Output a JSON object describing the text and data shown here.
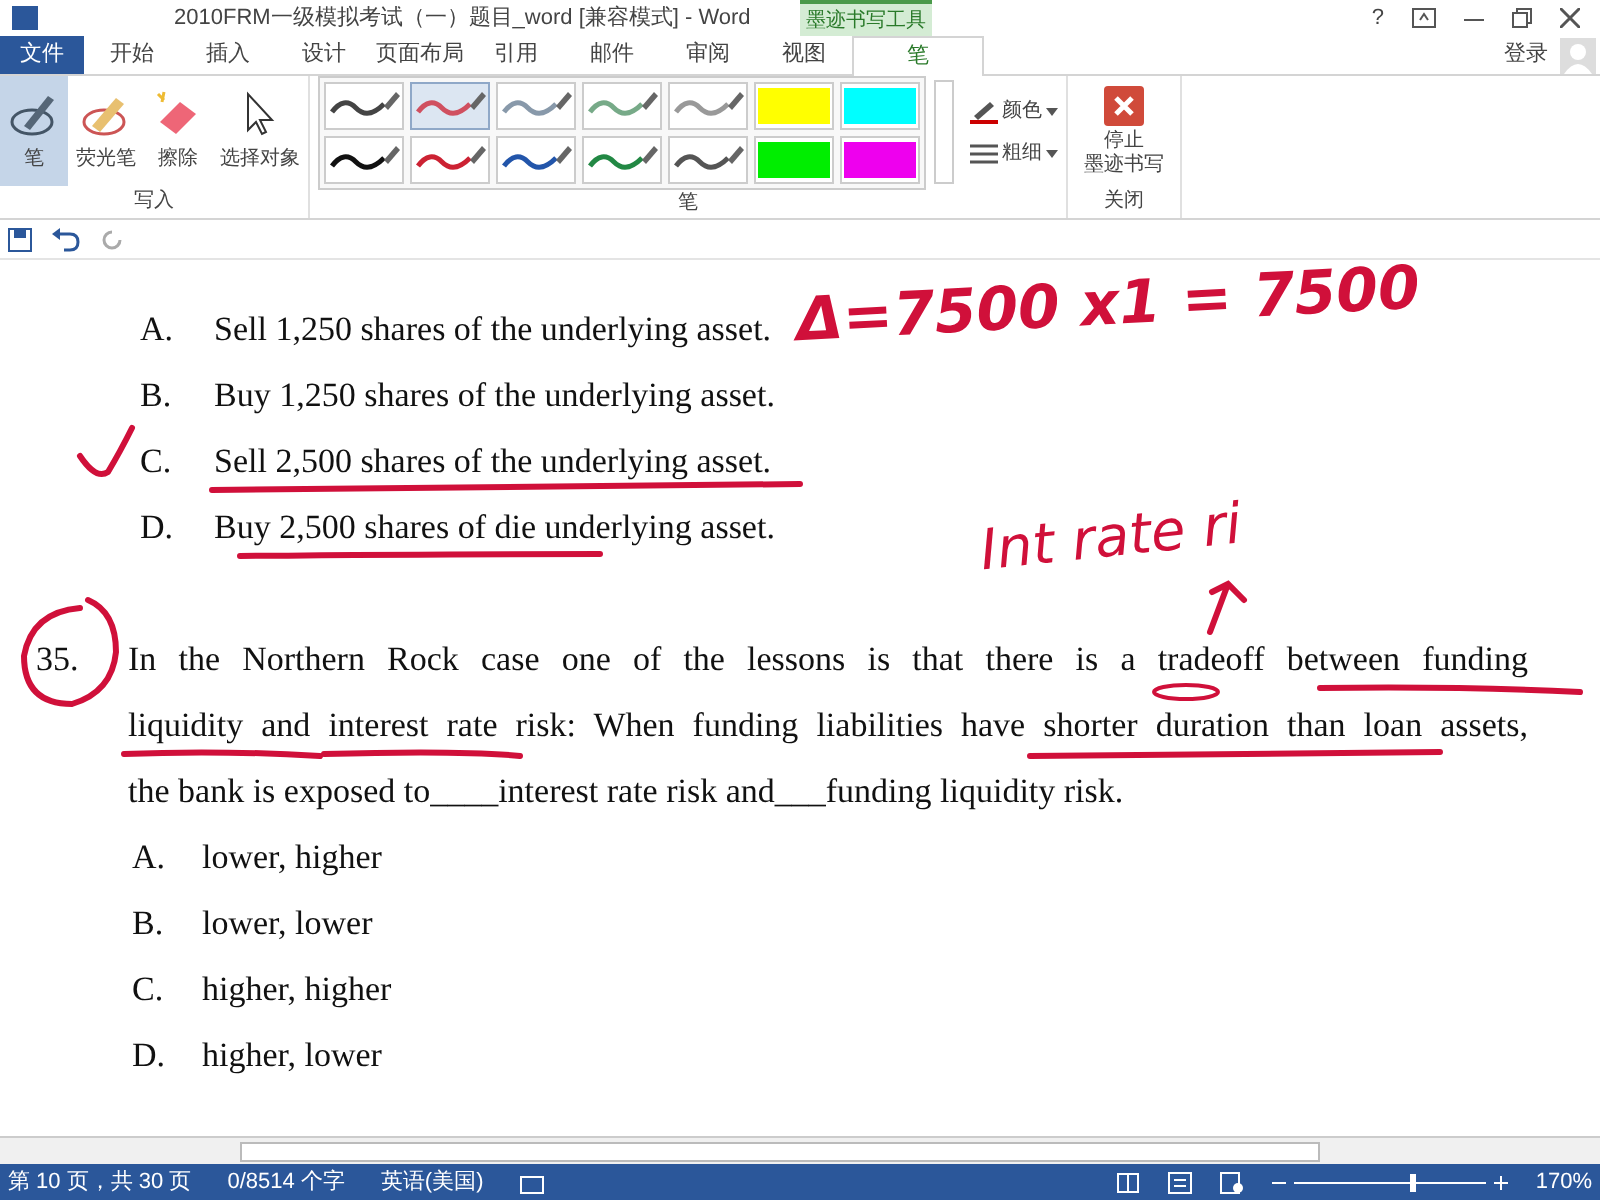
{
  "window": {
    "title": "2010FRM一级模拟考试（一）题目_word [兼容模式] - Word",
    "help": "?",
    "signin": "登录"
  },
  "tabs": [
    {
      "label": "文件",
      "kind": "file",
      "selected": false
    },
    {
      "label": "开始",
      "kind": "tab",
      "selected": false
    },
    {
      "label": "插入",
      "kind": "tab",
      "selected": false
    },
    {
      "label": "设计",
      "kind": "tab",
      "selected": false
    },
    {
      "label": "页面布局",
      "kind": "tab",
      "selected": false
    },
    {
      "label": "引用",
      "kind": "tab",
      "selected": false
    },
    {
      "label": "邮件",
      "kind": "tab",
      "selected": false
    },
    {
      "label": "审阅",
      "kind": "tab",
      "selected": false
    },
    {
      "label": "视图",
      "kind": "tab",
      "selected": false
    },
    {
      "label": "笔",
      "kind": "context",
      "selected": true
    }
  ],
  "context_group": "墨迹书写工具",
  "ribbon": {
    "write_tools": [
      {
        "label": "笔",
        "kind": "pen",
        "selected": true
      },
      {
        "label": "荧光笔",
        "kind": "highlighter",
        "selected": false
      },
      {
        "label": "擦除",
        "kind": "eraser",
        "selected": false
      },
      {
        "label": "选择对象",
        "kind": "pointer",
        "selected": false
      }
    ],
    "write_group": "写入",
    "pens": [
      {
        "kind": "pen",
        "color": "#444444",
        "selected": false
      },
      {
        "kind": "pen",
        "color": "#d05060",
        "selected": true
      },
      {
        "kind": "pen",
        "color": "#8899aa",
        "selected": false
      },
      {
        "kind": "pen",
        "color": "#77aa88",
        "selected": false
      },
      {
        "kind": "pen",
        "color": "#999999",
        "selected": false
      },
      {
        "kind": "highlighter",
        "color": "#ffff00",
        "selected": false
      },
      {
        "kind": "highlighter",
        "color": "#00ffff",
        "selected": false
      },
      {
        "kind": "pen",
        "color": "#111111",
        "selected": false
      },
      {
        "kind": "pen",
        "color": "#cc2233",
        "selected": false
      },
      {
        "kind": "pen",
        "color": "#2255aa",
        "selected": false
      },
      {
        "kind": "pen",
        "color": "#228844",
        "selected": false
      },
      {
        "kind": "pen",
        "color": "#555555",
        "selected": false
      },
      {
        "kind": "highlighter",
        "color": "#00ee00",
        "selected": false
      },
      {
        "kind": "highlighter",
        "color": "#ee00ee",
        "selected": false
      }
    ],
    "color_button": "颜色",
    "thickness_button": "粗细",
    "pen_group": "笔",
    "stop_button": [
      "停止",
      "墨迹书写"
    ],
    "close_group": "关闭"
  },
  "document": {
    "options_top": [
      {
        "letter": "A.",
        "text": "Sell 1,250 shares of the underlying asset."
      },
      {
        "letter": "B.",
        "text": "Buy 1,250 shares of the underlying asset."
      },
      {
        "letter": "C.",
        "text": "Sell 2,500 shares of the underlying asset."
      },
      {
        "letter": "D.",
        "text": "Buy 2,500 shares of die underlying asset."
      }
    ],
    "question": {
      "number": "35.",
      "lines": [
        "In the Northern Rock case one of the lessons is that there is a tradeoff between funding",
        "liquidity and interest rate risk: When funding liabilities have shorter duration than loan assets,",
        "the bank is exposed to____interest rate risk and___funding liquidity risk."
      ]
    },
    "options": [
      {
        "letter": "A.",
        "text": "lower, higher"
      },
      {
        "letter": "B.",
        "text": "lower, lower"
      },
      {
        "letter": "C.",
        "text": "higher, higher"
      },
      {
        "letter": "D.",
        "text": "higher, lower"
      }
    ],
    "ink_notes": [
      "Δ=7500 x1 = 7500",
      "Int rate ri"
    ]
  },
  "status_bar": {
    "page": "第 10 页，共 30 页",
    "words": "0/8514 个字",
    "language": "英语(美国)",
    "zoom": "170%",
    "zoom_slider": {
      "level": 0.62
    }
  }
}
